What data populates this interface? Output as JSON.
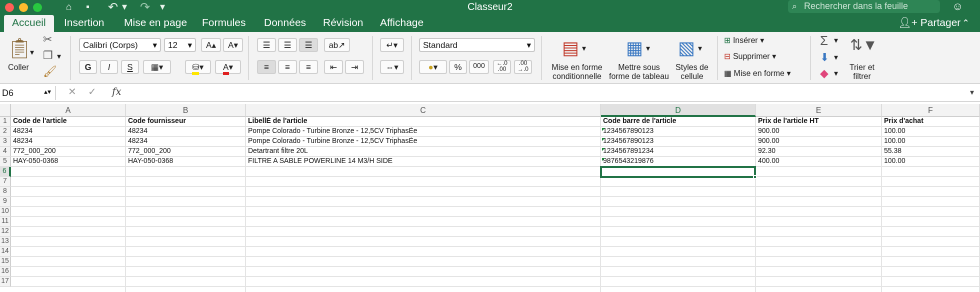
{
  "window": {
    "title": "Classeur2",
    "search_placeholder": "Rechercher dans la feuille"
  },
  "quick_access": {
    "home": "⌂",
    "save": "▪",
    "undo": "↶",
    "undo_menu": "▾",
    "redo": "↷",
    "customize": "▾"
  },
  "tabs": [
    "Accueil",
    "Insertion",
    "Mise en page",
    "Formules",
    "Données",
    "Révision",
    "Affichage"
  ],
  "share_label": "Partager",
  "ribbon": {
    "paste_label": "Coller",
    "font_name": "Calibri (Corps)",
    "font_size": "12",
    "bold": "G",
    "italic": "I",
    "underline": "S",
    "number_format": "Standard",
    "conditional_format": [
      "Mise en forme",
      "conditionnelle"
    ],
    "format_table": [
      "Mettre sous",
      "forme de tableau"
    ],
    "cell_styles": [
      "Styles de",
      "cellule"
    ],
    "insert_label": "Insérer",
    "delete_label": "Supprimer",
    "format_label": "Mise en forme",
    "sort_filter": [
      "Trier et",
      "filtrer"
    ],
    "percent": "%",
    "thousands": "000"
  },
  "formula_bar": {
    "cell_ref": "D6",
    "fx": "fx",
    "value": ""
  },
  "columns": [
    "A",
    "B",
    "C",
    "D",
    "E",
    "F"
  ],
  "rows": [
    "1",
    "2",
    "3",
    "4",
    "5",
    "6",
    "7",
    "8",
    "9",
    "10",
    "11",
    "12",
    "13",
    "14",
    "15",
    "16",
    "17"
  ],
  "cells": [
    [
      "Code de l'article",
      "Code fournisseur",
      "LibellÈ de l'article",
      "Code barre de l'article",
      "Prix de l'article HT",
      "Prix d'achat"
    ],
    [
      "48234",
      "48234",
      "Pompe Colorado - Turbine Bronze - 12,5CV TriphasÈe",
      "1234567890123",
      "900.00",
      "100.00"
    ],
    [
      "48234",
      "48234",
      "Pompe Colorado - Turbine Bronze - 12,5CV TriphasÈe",
      "1234567890123",
      "900.00",
      "100.00"
    ],
    [
      "772_000_200",
      "772_000_200",
      "Detartrant filtre 20L",
      "1234567891234",
      "92.30",
      "55.38"
    ],
    [
      "HAY-050-0368",
      "HAY-050-0368",
      "FILTRE A SABLE POWERLINE 14 M3/H SIDE",
      "9876543219876",
      "400.00",
      "100.00"
    ]
  ],
  "selected_cell": "D6",
  "colors": {
    "accent": "#217346",
    "error_flag": "#1e8a3c"
  }
}
